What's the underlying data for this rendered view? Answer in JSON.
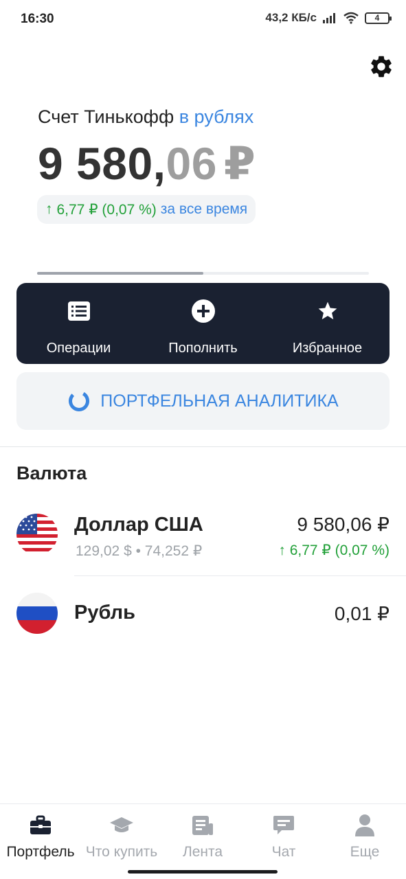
{
  "status_bar": {
    "time": "16:30",
    "speed": "43,2 КБ/с",
    "battery": "4",
    "icons": [
      "signal-icon",
      "wifi-icon",
      "battery-icon"
    ]
  },
  "header": {
    "settings_icon": "gear-icon",
    "account_title": "Счет Тинькофф",
    "account_currency_link": "в рублях",
    "balance_int": "9 580,",
    "balance_cents": "06",
    "balance_currency": "₽",
    "change_arrow": "↑",
    "change_value": "6,77 ₽ (0,07 %)",
    "change_period": "за все время",
    "progress": 0.5
  },
  "actions": [
    {
      "label": "Операции",
      "icon": "list-icon"
    },
    {
      "label": "Пополнить",
      "icon": "plus-circle-icon"
    },
    {
      "label": "Избранное",
      "icon": "star-icon"
    }
  ],
  "analytics": {
    "label": "ПОРТФЕЛЬНАЯ АНАЛИТИКА",
    "icon": "donut-chart-icon"
  },
  "section": {
    "title": "Валюта"
  },
  "currencies": [
    {
      "name": "Доллар США",
      "sub": "129,02 $ • 74,252 ₽",
      "amount": "9 580,06 ₽",
      "change_arrow": "↑",
      "change": "6,77 ₽ (0,07 %)",
      "flag": "us-flag-icon"
    },
    {
      "name": "Рубль",
      "amount": "0,01 ₽",
      "flag": "ru-flag-icon"
    }
  ],
  "tabs": [
    {
      "label": "Портфель",
      "icon": "briefcase-icon",
      "active": true
    },
    {
      "label": "Что купить",
      "icon": "graduation-cap-icon",
      "active": false
    },
    {
      "label": "Лента",
      "icon": "newspaper-icon",
      "active": false
    },
    {
      "label": "Чат",
      "icon": "chat-icon",
      "active": false
    },
    {
      "label": "Еще",
      "icon": "user-icon",
      "active": false
    }
  ],
  "colors": {
    "accent": "#3b86e0",
    "positive": "#21a038",
    "panel": "#1a2131",
    "muted": "#9e9e9e"
  }
}
